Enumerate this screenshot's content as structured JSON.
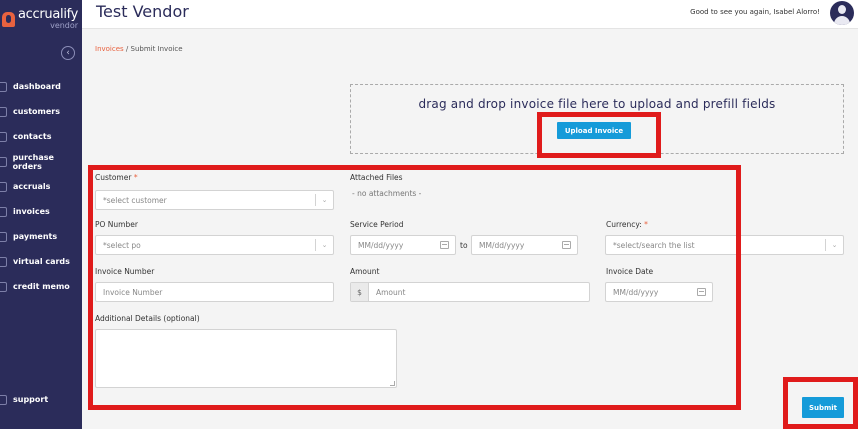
{
  "brand": {
    "name": "accrualify",
    "sub": "vendor"
  },
  "sidebar": {
    "collapse_icon": "chevron-left-icon",
    "items": [
      {
        "label": "dashboard",
        "icon": "dashboard-icon"
      },
      {
        "label": "customers",
        "icon": "customers-icon"
      },
      {
        "label": "contacts",
        "icon": "contacts-icon"
      },
      {
        "label": "purchase orders",
        "icon": "purchase-orders-icon"
      },
      {
        "label": "accruals",
        "icon": "accruals-icon"
      },
      {
        "label": "invoices",
        "icon": "invoices-icon"
      },
      {
        "label": "payments",
        "icon": "payments-icon"
      },
      {
        "label": "virtual cards",
        "icon": "virtual-cards-icon"
      },
      {
        "label": "credit memo",
        "icon": "credit-memo-icon"
      }
    ],
    "support": "support"
  },
  "header": {
    "title": "Test Vendor",
    "greeting": "Good to see you again, Isabel Alorro!"
  },
  "breadcrumb": {
    "link": "Invoices",
    "separator": " / ",
    "current": "Submit Invoice"
  },
  "upload": {
    "text": "drag and drop invoice file here to upload and prefill fields",
    "button": "Upload Invoice"
  },
  "form": {
    "customer_label": "Customer",
    "required_mark": "*",
    "customer_placeholder": "*select customer",
    "attached_label": "Attached Files",
    "attached_value": "- no attachments -",
    "po_label": "PO Number",
    "po_placeholder": "*select po",
    "service_label": "Service Period",
    "date_placeholder": "MM/dd/yyyy",
    "to_label": "to",
    "currency_label": "Currency:",
    "currency_placeholder": "*select/search the list",
    "invoice_number_label": "Invoice Number",
    "invoice_number_placeholder": "Invoice Number",
    "amount_label": "Amount",
    "amount_prefix": "$",
    "amount_placeholder": "Amount",
    "invoice_date_label": "Invoice Date",
    "details_label": "Additional Details (optional)",
    "submit": "Submit"
  },
  "colors": {
    "sidebar": "#2b2c5a",
    "accent": "#e8623f",
    "button": "#159bd9",
    "annotation": "#e01b1b"
  }
}
